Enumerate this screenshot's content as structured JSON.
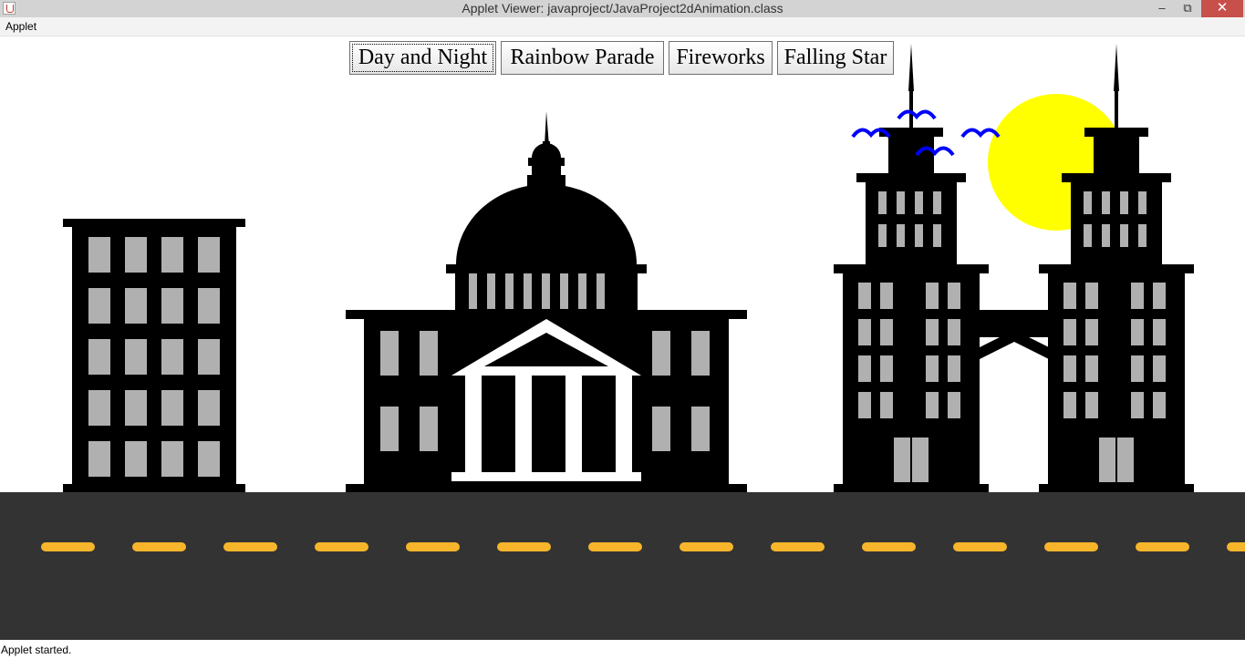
{
  "window": {
    "title": "Applet Viewer: javaproject/JavaProject2dAnimation.class",
    "minimize_glyph": "–",
    "maximize_glyph": "⧉",
    "close_glyph": "✕"
  },
  "menubar": {
    "applet_label": "Applet"
  },
  "buttons": {
    "day_night": "Day and Night",
    "rainbow": "Rainbow Parade",
    "fireworks": "Fireworks",
    "falling_star": "Falling Star"
  },
  "status": {
    "text": "Applet started."
  },
  "colors": {
    "sky": "#ffffff",
    "building": "#000000",
    "window": "#b0b0b0",
    "road": "#333333",
    "lane_marking": "#f7b52b",
    "sun": "#ffff00",
    "birds": "#0000ff"
  },
  "icons": [
    "java-app-icon",
    "minimize-icon",
    "maximize-icon",
    "close-icon"
  ]
}
